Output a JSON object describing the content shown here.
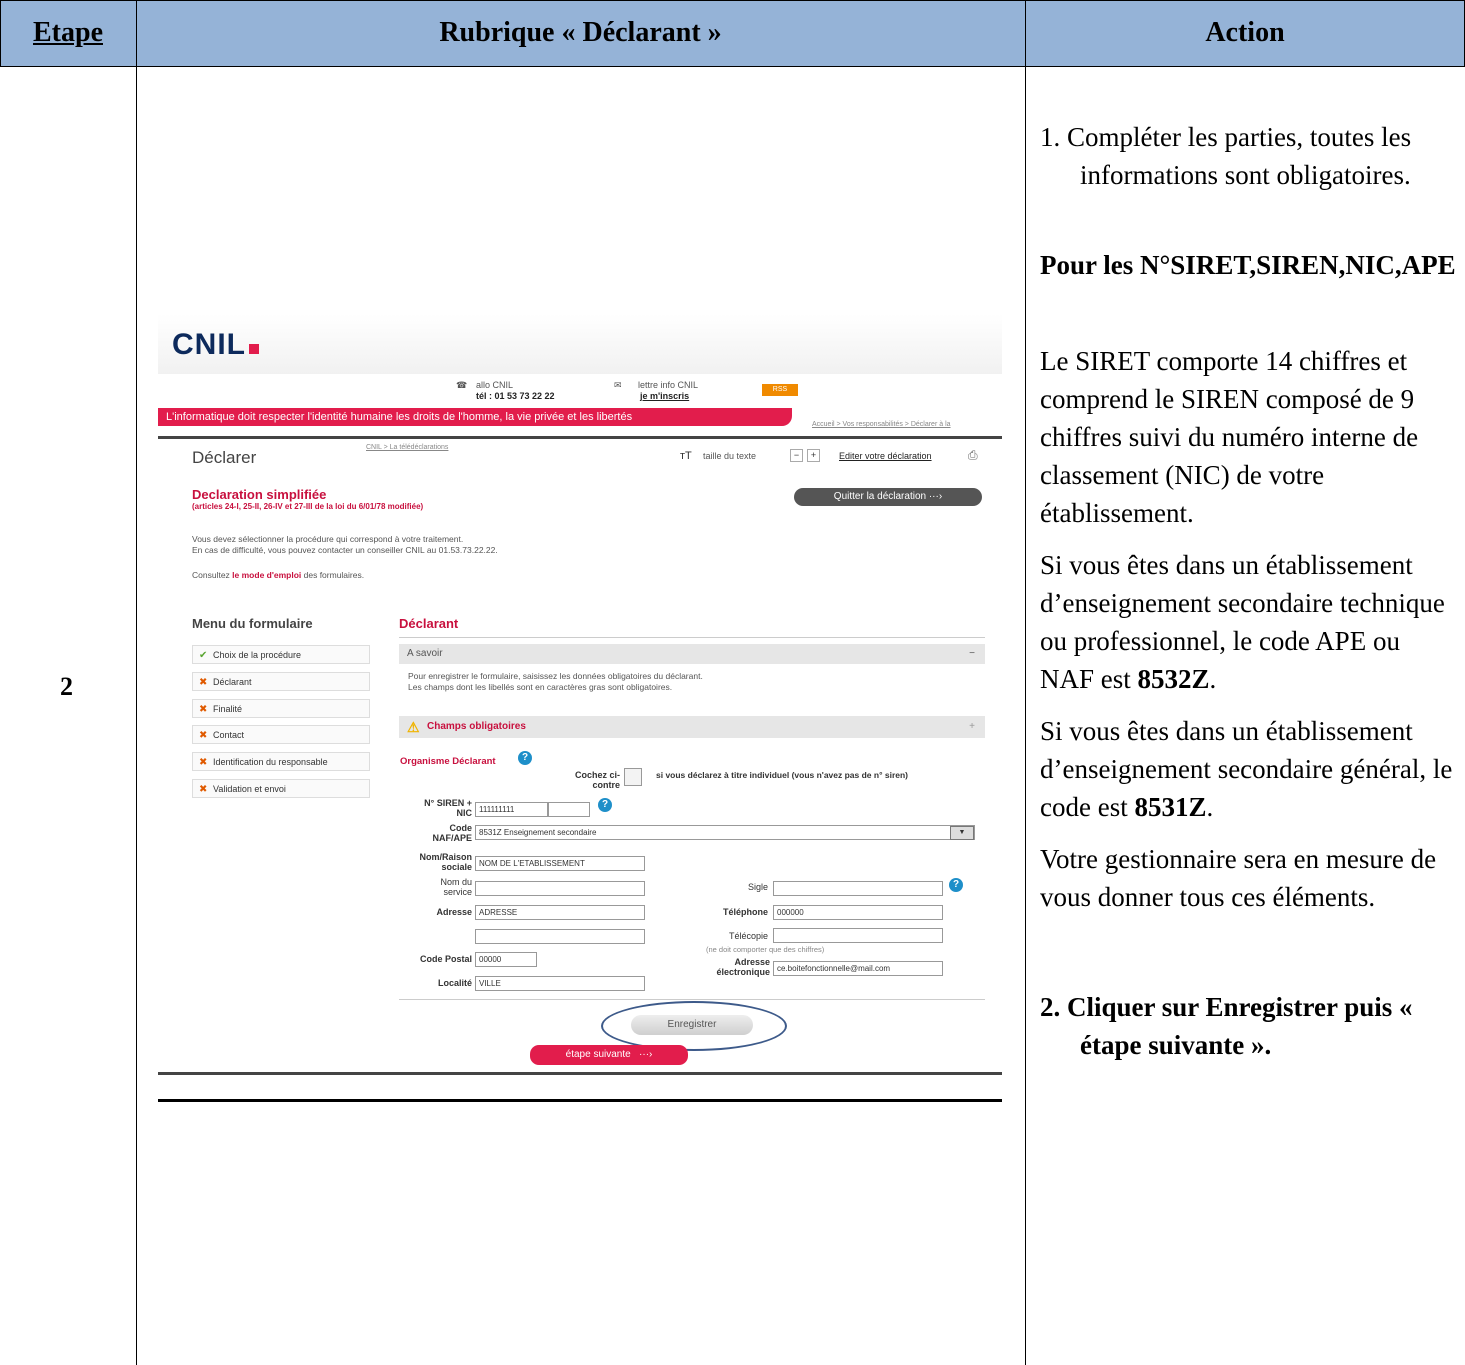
{
  "table": {
    "headers": [
      "Etape",
      "Rubrique « Déclarant »",
      "Action"
    ],
    "step": "2"
  },
  "action": {
    "item1": "1. Compléter les parties, toutes les informations sont obligatoires.",
    "pour_les": "Pour les N°SIRET,SIREN,NIC,APE",
    "para_siret": "Le SIRET comporte 14 chiffres et comprend le SIREN composé de 9 chiffres suivi du numéro interne de classement (NIC) de votre établissement.",
    "para_tech_a": "Si vous êtes dans un établissement d’enseignement secondaire technique ou professionnel, le code APE ou NAF est ",
    "para_tech_b": "8532Z",
    "para_gen_a": "Si vous êtes dans un établissement d’enseignement secondaire général, le code est ",
    "para_gen_b": "8531Z",
    "para_gest": "Votre gestionnaire sera en mesure de vous donner tous ces éléments.",
    "item2": "2. Cliquer sur Enregistrer puis « étape suivante »."
  },
  "screenshot": {
    "logo": "CNIL",
    "allo": "allo CNIL",
    "tel": "tél : 01 53 73 22 22",
    "lettre": "lettre info CNIL",
    "inscris": "je m'inscris",
    "rss": "RSS",
    "banner": "L'informatique doit respecter l'identité humaine les droits de l'homme, la vie privée et les libertés",
    "breadcrumb_top": "Accueil > Vos responsabilités > Déclarer à la",
    "breadcrumb": "CNIL > La télédéclarations",
    "page_title": "Déclarer",
    "text_size": "taille du texte",
    "edit": "Editer votre déclaration",
    "decl_title": "Declaration simplifiée",
    "decl_sub": "(articles 24-I, 25-II, 26-IV et 27-III de la loi du 6/01/78 modifiée)",
    "quit": "Quitter la déclaration",
    "intro1": "Vous devez sélectionner la procédure qui correspond à votre traitement.",
    "intro2": "En cas de difficulté, vous pouvez contacter un conseiller CNIL au 01.53.73.22.22.",
    "consult_a": "Consultez ",
    "consult_link": "le mode d'emploi",
    "consult_b": " des formulaires.",
    "menu_title": "Menu du formulaire",
    "menu": [
      "Choix de la procédure",
      "Déclarant",
      "Finalité",
      "Contact",
      "Identification du responsable",
      "Validation et envoi"
    ],
    "section_title": "Déclarant",
    "a_savoir": "A savoir",
    "info1": "Pour enregistrer le formulaire, saisissez les données obligatoires du déclarant.",
    "info2": "Les champs dont les libellés sont en caractères gras sont obligatoires.",
    "champs": "Champs obligatoires",
    "organisme": "Organisme Déclarant",
    "cochez": "Cochez ci-contre",
    "individuel": "si vous déclarez à titre individuel (vous n'avez pas de n° siren)",
    "siren_lbl": "N° SIREN + NIC",
    "siren_val": "111111111",
    "naf_lbl": "Code NAF/APE",
    "naf_val": "8531Z Enseignement secondaire",
    "nom_lbl": "Nom/Raison sociale",
    "nom_val": "NOM DE L'ETABLISSEMENT",
    "service_lbl": "Nom du service",
    "sigle_lbl": "Sigle",
    "adresse_lbl": "Adresse",
    "adresse_val": "ADRESSE",
    "tel_lbl": "Téléphone",
    "tel_val": "000000",
    "fax_lbl": "Télécopie",
    "fax_note": "(ne doit comporter que des chiffres)",
    "cp_lbl": "Code Postal",
    "cp_val": "00000",
    "email_lbl": "Adresse électronique",
    "email_val": "ce.boitefonctionnelle@mail.com",
    "ville_lbl": "Localité",
    "ville_val": "VILLE",
    "save": "Enregistrer",
    "next": "étape suivante"
  }
}
